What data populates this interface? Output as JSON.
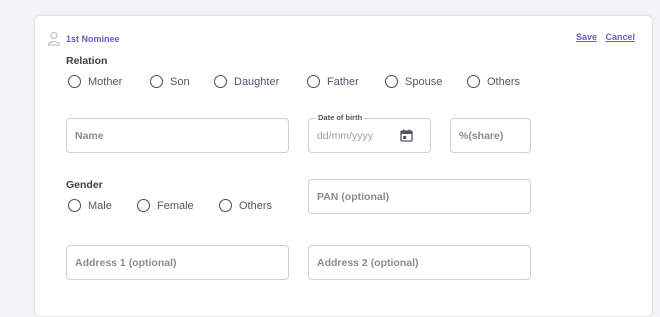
{
  "nominee": {
    "title": "1st Nominee",
    "save_label": "Save",
    "cancel_label": "Cancel"
  },
  "relation": {
    "label": "Relation",
    "options": [
      "Mother",
      "Son",
      "Daughter",
      "Father",
      "Spouse",
      "Others"
    ]
  },
  "fields": {
    "name_placeholder": "Name",
    "dob_label": "Date of birth",
    "dob_placeholder": "dd/mm/yyyy",
    "share_placeholder": "%(share)",
    "pan_placeholder": "PAN (optional)",
    "address1_placeholder": "Address 1 (optional)",
    "address2_placeholder": "Address 2 (optional)"
  },
  "gender": {
    "label": "Gender",
    "options": [
      "Male",
      "Female",
      "Others"
    ]
  },
  "colors": {
    "accent": "#6b5bc7",
    "border": "#cfcfd8"
  },
  "icons": {
    "header": "user-icon",
    "date": "calendar-icon"
  }
}
